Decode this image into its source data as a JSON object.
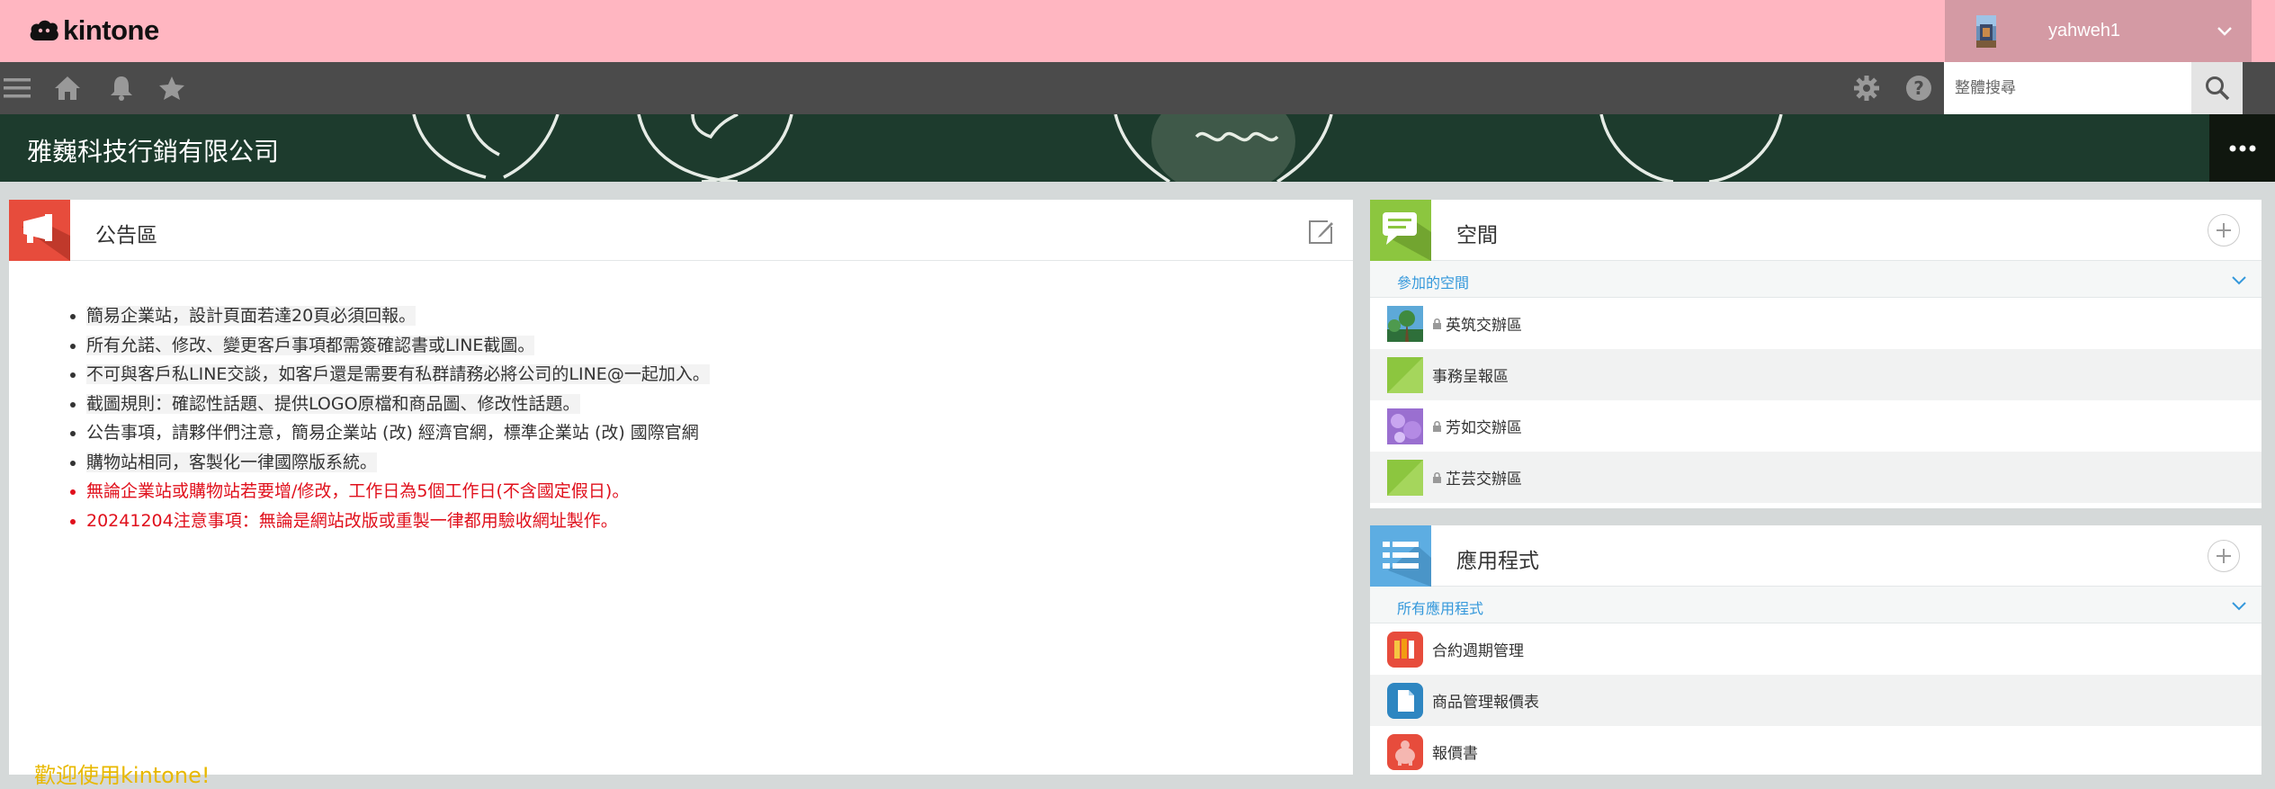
{
  "app": {
    "logo_text": "kintone"
  },
  "user": {
    "name": "yahweh1"
  },
  "search": {
    "placeholder": "整體搜尋"
  },
  "banner": {
    "title": "雅巍科技行銷有限公司"
  },
  "announcement": {
    "title": "公告區",
    "items": [
      "簡易企業站，設計頁面若達20頁必須回報。",
      "所有允諾、修改、變更客戶事項都需簽確認書或LINE截圖。",
      "不可與客戶私LINE交談，如客戶還是需要有私群請務必將公司的LINE@一起加入。",
      "截圖規則：確認性話題、提供LOGO原檔和商品圖、修改性話題。",
      "公告事項，請夥伴們注意，簡易企業站 (改) 經濟官網，標準企業站 (改) 國際官網",
      "購物站相同，客製化一律國際版系統。",
      "無論企業站或購物站若要增/修改，工作日為5個工作日(不含國定假日)。",
      "20241204注意事項：無論是網站改版或重製一律都用驗收網址製作。"
    ],
    "welcome": "歡迎使用kintone!"
  },
  "spaces": {
    "title": "空間",
    "filter_label": "參加的空間",
    "items": [
      {
        "label": "英筑交辦區",
        "locked": true
      },
      {
        "label": "事務呈報區",
        "locked": false
      },
      {
        "label": "芳如交辦區",
        "locked": true
      },
      {
        "label": "芷芸交辦區",
        "locked": true
      }
    ]
  },
  "apps": {
    "title": "應用程式",
    "filter_label": "所有應用程式",
    "items": [
      {
        "label": "合約週期管理"
      },
      {
        "label": "商品管理報價表"
      },
      {
        "label": "報價書"
      }
    ]
  },
  "colors": {
    "header_bg": "#ffb6c1",
    "toolbar_bg": "#4b4b4b",
    "announce_badge": "#e74c3c",
    "spaces_badge": "#8cc63f",
    "apps_badge": "#5dade2",
    "link_blue": "#3498db",
    "alert_red": "#e0101c",
    "welcome_yellow": "#e8b800"
  },
  "icons": {
    "menu": "hamburger-icon",
    "home": "home-icon",
    "notifications": "bell-icon",
    "favorites": "star-icon",
    "settings": "gear-icon",
    "help": "help-icon",
    "search": "search-icon",
    "more": "more-icon"
  }
}
